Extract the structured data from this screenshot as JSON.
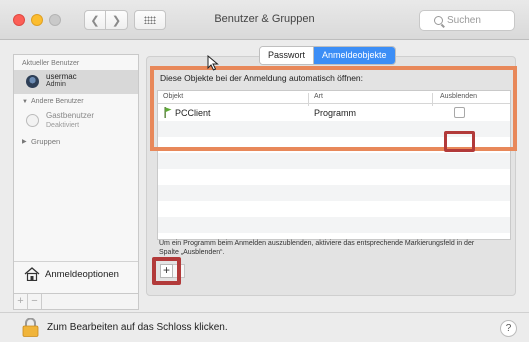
{
  "window": {
    "title": "Benutzer & Gruppen",
    "search_placeholder": "Suchen"
  },
  "sidebar": {
    "current_user_heading": "Aktueller Benutzer",
    "current_user": {
      "name": "usermac",
      "role": "Admin"
    },
    "other_users_heading": "Andere Benutzer",
    "guest": {
      "name": "Gastbenutzer",
      "status": "Deaktiviert"
    },
    "groups_label": "Gruppen",
    "login_options_label": "Anmeldeoptionen"
  },
  "tabs": {
    "password": "Passwort",
    "login_items": "Anmeldeobjekte",
    "active": "login_items"
  },
  "login_items": {
    "instruction": "Diese Objekte bei der Anmeldung automatisch öffnen:",
    "columns": {
      "object": "Objekt",
      "kind": "Art",
      "hide": "Ausblenden"
    },
    "rows": [
      {
        "object": "PCClient",
        "kind": "Programm",
        "hide": false
      }
    ],
    "hint": "Um ein Programm beim Anmelden auszublenden, aktiviere das entsprechende Markierungsfeld in der Spalte „Ausblenden“."
  },
  "footer": {
    "lock_text": "Zum Bearbeiten auf das Schloss klicken.",
    "help_label": "?"
  },
  "buttons": {
    "add": "+",
    "remove": "−"
  },
  "colors": {
    "accent": "#3c8ef6",
    "highlight_orange": "#e8885a",
    "highlight_red": "#b23a3a"
  }
}
